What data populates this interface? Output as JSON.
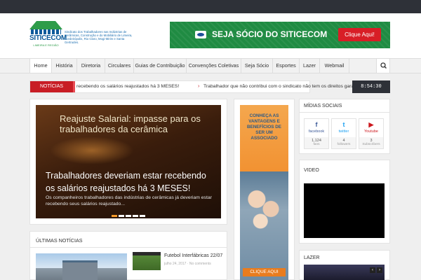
{
  "header": {
    "logo_word": "SITICECOM",
    "logo_sub": "LIMEIRA E REGIÃO",
    "tagline": "Sindicato dos Trabalhadores nas Indústrias de Cerâmicas, Construção e do Mobiliário de Limeira, Cordeirópolis, Rio Claro, Mogi-Mirim e Santa Gertrudes.",
    "banner_text": "SEJA SÓCIO DO SITICECOM",
    "banner_button": "Clique Aqui!"
  },
  "nav": {
    "items": [
      "Home",
      "História",
      "Diretoria",
      "Circulares",
      "Guias de Contribuição",
      "Convenções Coletivas",
      "Seja Sócio",
      "Esportes",
      "Lazer",
      "Webmail"
    ],
    "search_icon": "search-icon"
  },
  "ticker": {
    "label": "NOTÍCIAS",
    "item1": "recebendo os salários reajustados há 3 MESES!",
    "item2": "Trabalhador que não contribui com o sindicato não tem os direitos gara",
    "clock": "8:54:30"
  },
  "slider": {
    "image_title": "Reajuste Salarial: impasse para os trabalhadores da cerâmica",
    "headline": "Trabalhadores deveriam estar recebendo os salários reajustados há 3 MESES!",
    "excerpt": "Os companheiros trabalhadores das indústrias de cerâmicas já deveriam estar recebendo seus salários reajustado...",
    "active_slide": 1,
    "slide_count": 5
  },
  "ad": {
    "text": "CONHEÇA AS VANTAGENS E BENEFÍCIOS DE SER UM ASSOCIADO",
    "button": "CLIQUE AQUI"
  },
  "sidebar": {
    "social_title": "MÍDIAS SOCIAIS",
    "social": [
      {
        "name": "facebook",
        "count": "1,124",
        "unit": "fans",
        "icon": "facebook-icon",
        "color": "#3b5998",
        "glyph": "f"
      },
      {
        "name": "twitter",
        "count": "4",
        "unit": "followers",
        "icon": "twitter-icon",
        "color": "#1da1f2",
        "glyph": "t"
      },
      {
        "name": "Youtube",
        "count": "3",
        "unit": "Subscribers",
        "icon": "youtube-icon",
        "color": "#cc181e",
        "glyph": "▶"
      }
    ],
    "video_title": "VIDEO",
    "lazer_title": "LAZER"
  },
  "news": {
    "section_title": "ÚLTIMAS NOTÍCIAS",
    "item2_title": "Futebol Interfábricas 22/07",
    "item2_date": "julho 24, 2017",
    "item2_comments": "No comments"
  },
  "colors": {
    "topbar": "#2e3138",
    "accent_red": "#c81d25",
    "banner_green": "#1f8b42",
    "logo_blue": "#0d5a9a",
    "slider_active": "#f59a2a"
  }
}
